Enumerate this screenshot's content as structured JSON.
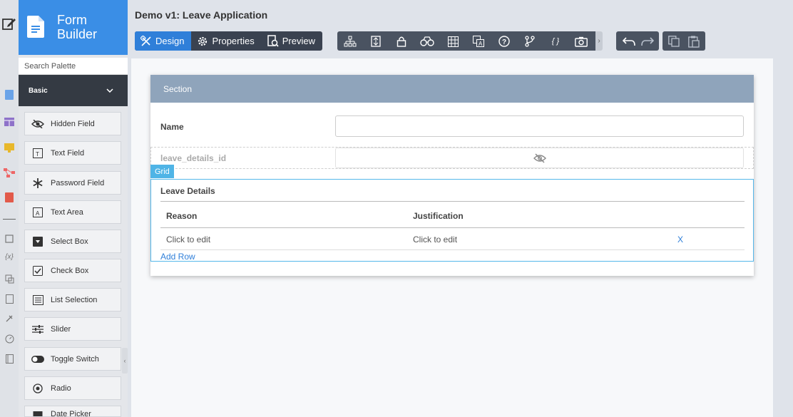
{
  "brand": {
    "line1": "Form",
    "line2": "Builder"
  },
  "palette": {
    "search_placeholder": "Search Palette",
    "category": "Basic",
    "items": [
      {
        "label": "Hidden Field",
        "icon": "eye-slash-icon"
      },
      {
        "label": "Text Field",
        "icon": "text-field-icon"
      },
      {
        "label": "Password Field",
        "icon": "asterisk-icon"
      },
      {
        "label": "Text Area",
        "icon": "text-area-icon"
      },
      {
        "label": "Select Box",
        "icon": "select-box-icon"
      },
      {
        "label": "Check Box",
        "icon": "checkbox-icon"
      },
      {
        "label": "List Selection",
        "icon": "list-icon"
      },
      {
        "label": "Slider",
        "icon": "slider-icon"
      },
      {
        "label": "Toggle Switch",
        "icon": "toggle-icon"
      },
      {
        "label": "Radio",
        "icon": "radio-icon"
      },
      {
        "label": "Date Picker",
        "icon": "calendar-icon"
      }
    ]
  },
  "header": {
    "title": "Demo v1: Leave Application",
    "modes": [
      {
        "label": "Design",
        "icon": "design-icon",
        "active": true
      },
      {
        "label": "Properties",
        "icon": "gear-icon",
        "active": false
      },
      {
        "label": "Preview",
        "icon": "preview-icon",
        "active": false
      }
    ],
    "tools": [
      "sitemap-icon",
      "align-icon",
      "lock-icon",
      "binoculars-icon",
      "table-icon",
      "translate-icon",
      "help-icon",
      "branch-icon",
      "braces-icon",
      "camera-icon"
    ],
    "braces_glyph": "{ }"
  },
  "form": {
    "section_title": "Section",
    "name_label": "Name",
    "name_value": "",
    "hidden_label": "leave_details_id",
    "grid_tag": "Grid",
    "grid": {
      "title": "Leave Details",
      "columns": [
        "Reason",
        "Justification"
      ],
      "row": [
        "Click to edit",
        "Click to edit"
      ],
      "delete_label": "X",
      "add_row": "Add Row"
    }
  }
}
